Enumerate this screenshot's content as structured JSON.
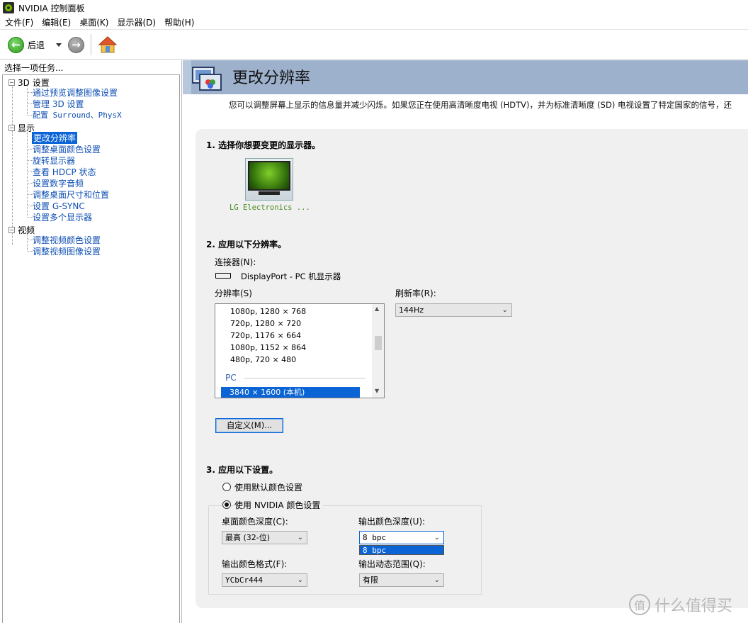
{
  "window": {
    "title": "NVIDIA 控制面板"
  },
  "menu": [
    "文件(F)",
    "编辑(E)",
    "桌面(K)",
    "显示器(D)",
    "帮助(H)"
  ],
  "toolbar": {
    "back_label": "后退"
  },
  "task_pane": {
    "header": "选择一项任务...",
    "groups": [
      {
        "label": "3D 设置",
        "items": [
          "通过预览调整图像设置",
          "管理 3D 设置",
          "配置 Surround、PhysX"
        ]
      },
      {
        "label": "显示",
        "items": [
          "更改分辨率",
          "调整桌面颜色设置",
          "旋转显示器",
          "查看 HDCP 状态",
          "设置数字音频",
          "调整桌面尺寸和位置",
          "设置 G-SYNC",
          "设置多个显示器"
        ]
      },
      {
        "label": "视频",
        "items": [
          "调整视频颜色设置",
          "调整视频图像设置"
        ]
      }
    ],
    "selected": "更改分辨率"
  },
  "page": {
    "title": "更改分辨率",
    "description": "您可以调整屏幕上显示的信息量并减少闪烁。如果您正在使用高清晰度电视 (HDTV)，并为标准清晰度 (SD) 电视设置了特定国家的信号，还"
  },
  "section1": {
    "title": "1. 选择你想要变更的显示器。",
    "display_name": "LG Electronics ..."
  },
  "section2": {
    "title": "2. 应用以下分辨率。",
    "connector_label": "连接器(N):",
    "connector_value": "DisplayPort - PC 机显示器",
    "resolution_label": "分辨率(S)",
    "resolutions": [
      "1080p, 1280 × 768",
      "720p, 1280 × 720",
      "720p, 1176 × 664",
      "1080p, 1152 × 864",
      "480p, 720 × 480"
    ],
    "group_label": "PC",
    "selected_resolution": "3840 × 1600 (本机)",
    "refresh_label": "刷新率(R):",
    "refresh_value": "144Hz",
    "custom_button": "自定义(M)..."
  },
  "section3": {
    "title": "3. 应用以下设置。",
    "radio_default": "使用默认颜色设置",
    "radio_nvidia": "使用 NVIDIA 颜色设置",
    "desktop_depth_label": "桌面颜色深度(C):",
    "desktop_depth_value": "最高 (32-位)",
    "output_depth_label": "输出颜色深度(U):",
    "output_depth_value": "8 bpc",
    "output_depth_option": "8 bpc",
    "output_format_label": "输出颜色格式(F):",
    "output_format_value": "YCbCr444",
    "output_range_label": "输出动态范围(Q):",
    "output_range_value": "有限"
  },
  "watermark": {
    "text": "什么值得买",
    "logo": "值"
  }
}
